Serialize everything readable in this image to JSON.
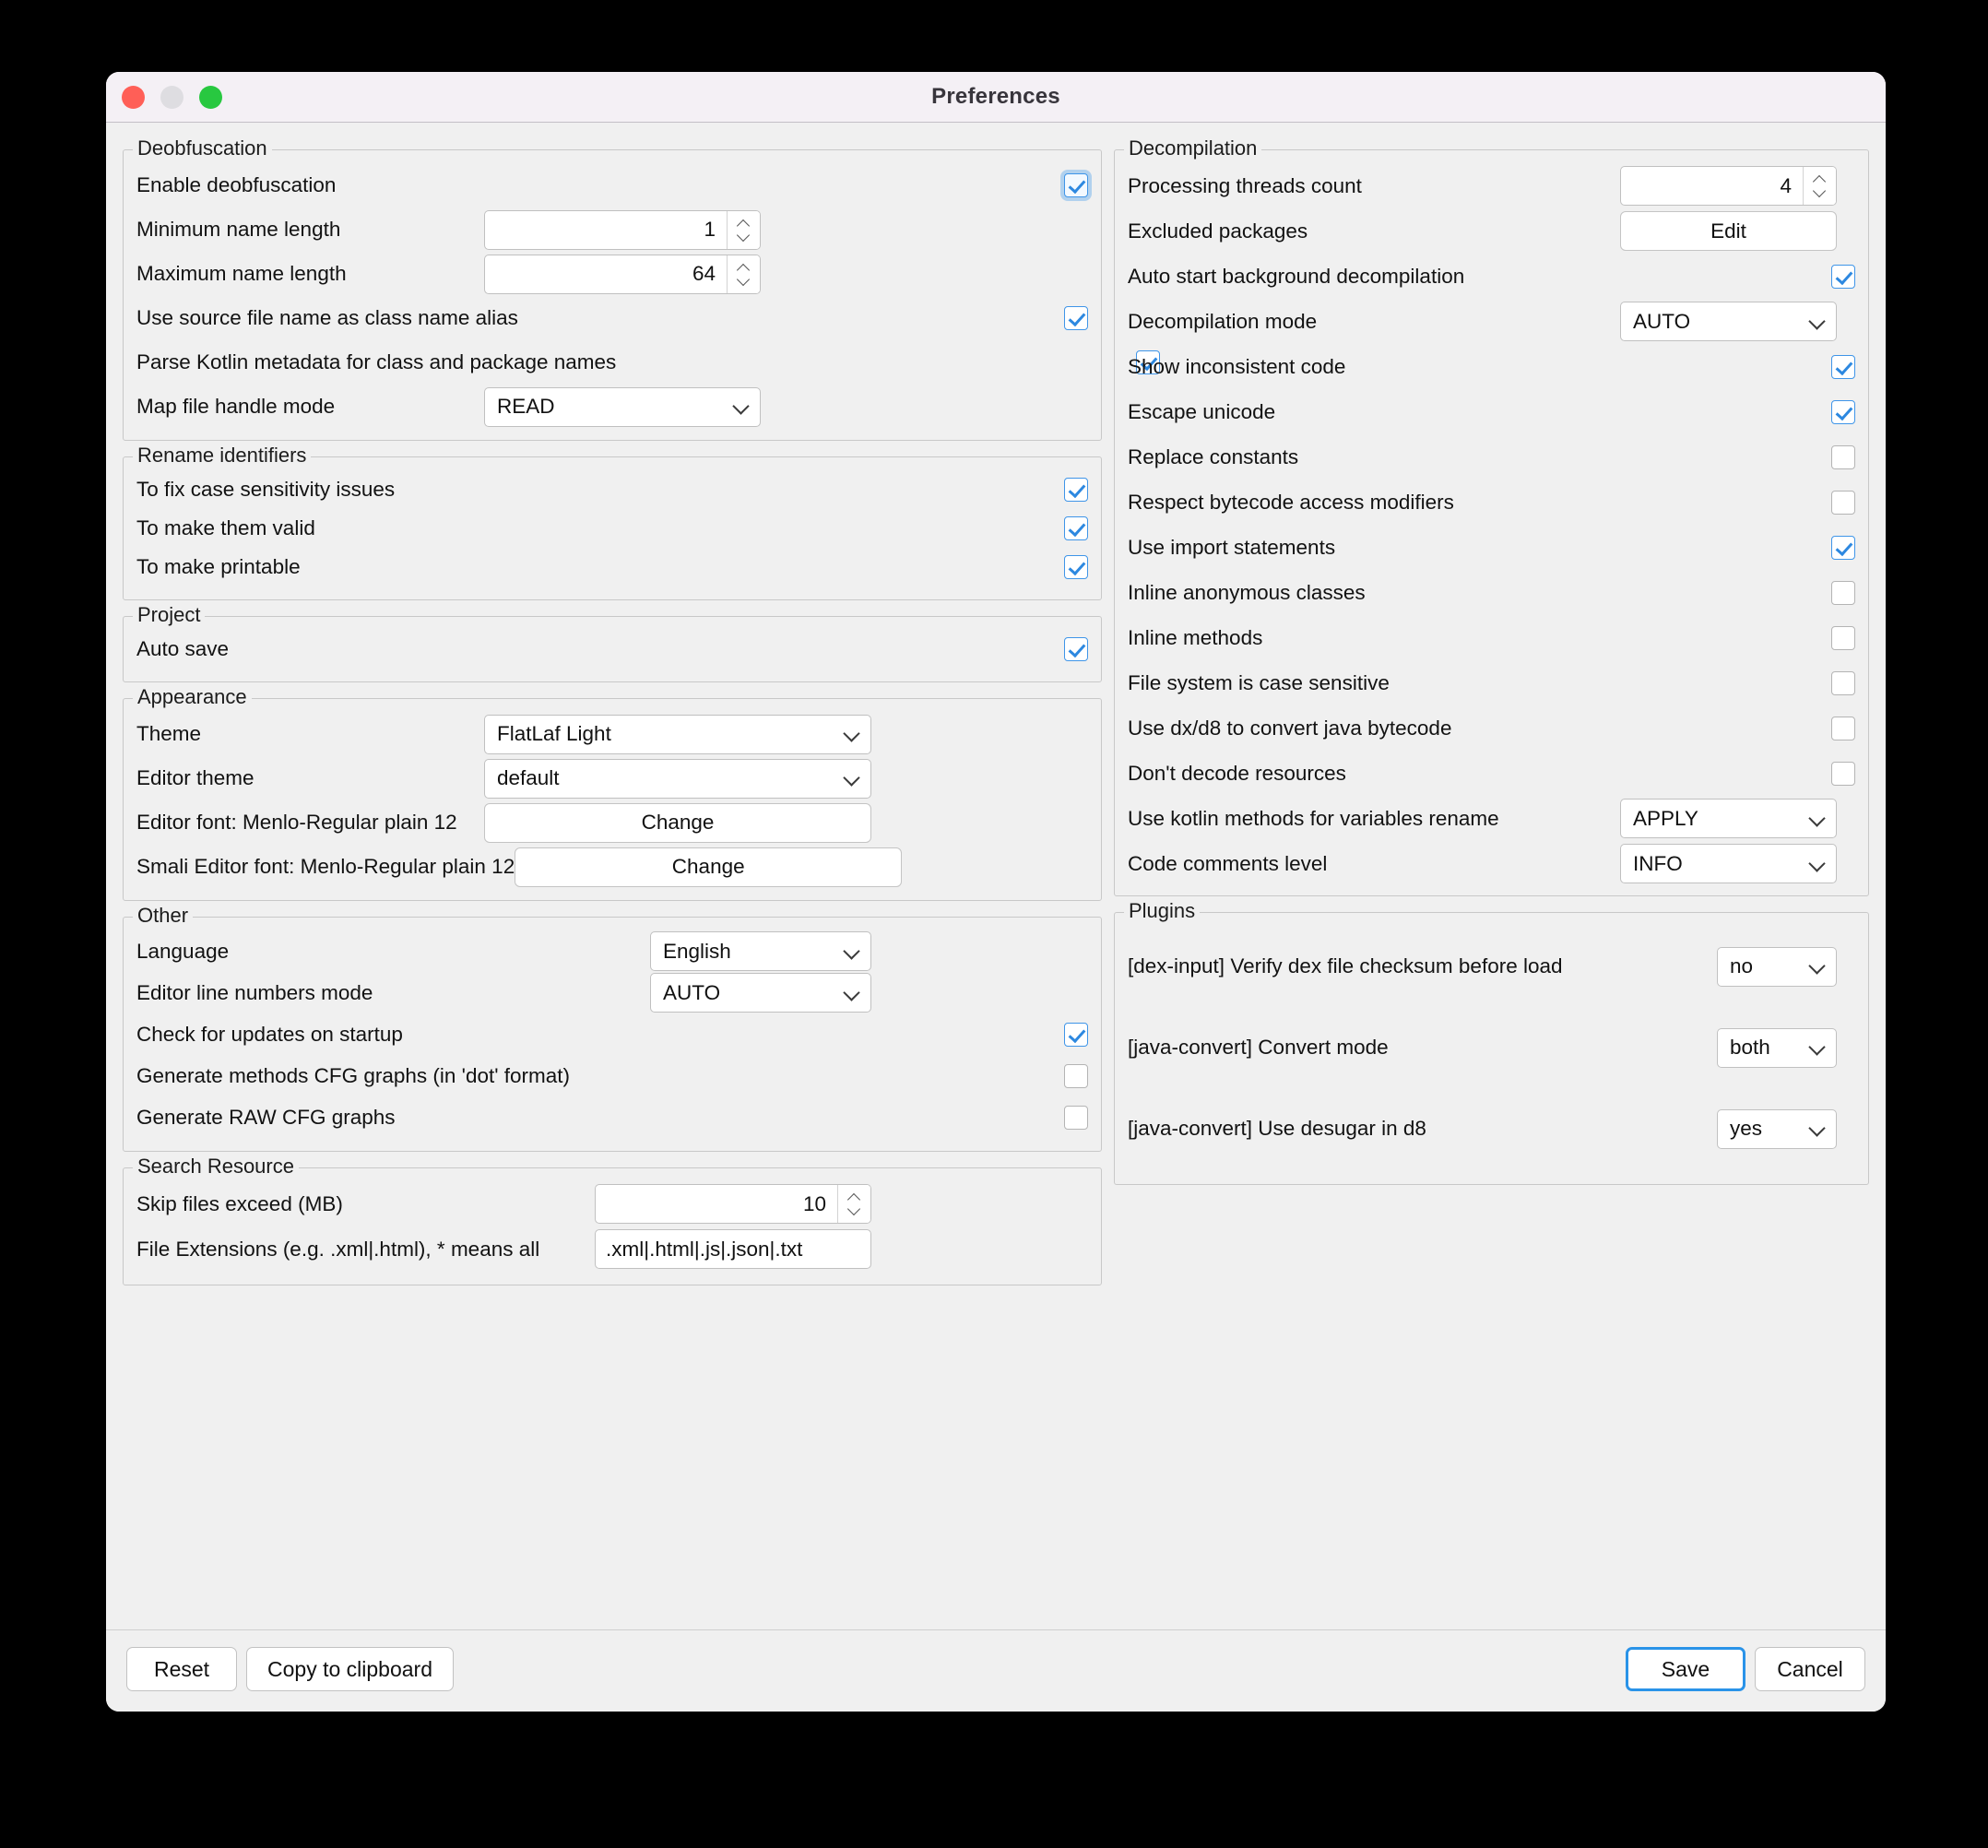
{
  "window": {
    "title": "Preferences",
    "traffic_lights": [
      "close-button",
      "minimize-button",
      "zoom-button"
    ]
  },
  "colors": {
    "accent": "#2a93e8",
    "checkbox_on": "#2d88e0",
    "close": "#ff5f57",
    "minimize": "#dedde1",
    "zoom": "#28c840",
    "window_bg": "#f0f0f0",
    "titlebar_bg": "#f4f0f5"
  },
  "left": {
    "deobfuscation": {
      "legend": "Deobfuscation",
      "rows": [
        {
          "label": "Enable deobfuscation",
          "type": "checkbox",
          "value": "on",
          "focused": true
        },
        {
          "label": "Minimum name length",
          "type": "spinner",
          "value": "1"
        },
        {
          "label": "Maximum name length",
          "type": "spinner",
          "value": "64"
        },
        {
          "label": "Use source file name as class name alias",
          "type": "checkbox",
          "value": "on"
        },
        {
          "label": "Parse Kotlin metadata for class and package names",
          "type": "checkbox",
          "value": "on"
        },
        {
          "label": "Map file handle mode",
          "type": "combo",
          "value": "READ"
        }
      ]
    },
    "rename_identifiers": {
      "legend": "Rename identifiers",
      "rows": [
        {
          "label": "To fix case sensitivity issues",
          "type": "checkbox",
          "value": "on"
        },
        {
          "label": "To make them valid",
          "type": "checkbox",
          "value": "on"
        },
        {
          "label": "To make printable",
          "type": "checkbox",
          "value": "on"
        }
      ]
    },
    "project": {
      "legend": "Project",
      "rows": [
        {
          "label": "Auto save",
          "type": "checkbox",
          "value": "on"
        }
      ]
    },
    "appearance": {
      "legend": "Appearance",
      "rows": [
        {
          "label": "Theme",
          "type": "combo",
          "value": "FlatLaf Light"
        },
        {
          "label": "Editor theme",
          "type": "combo",
          "value": "default"
        },
        {
          "label": "Editor font: Menlo-Regular plain 12",
          "type": "button",
          "value": "Change"
        },
        {
          "label": "Smali Editor font: Menlo-Regular plain 12",
          "type": "button",
          "value": "Change"
        }
      ]
    },
    "other": {
      "legend": "Other",
      "rows": [
        {
          "label": "Language",
          "type": "combo",
          "value": "English"
        },
        {
          "label": "Editor line numbers mode",
          "type": "combo",
          "value": "AUTO"
        },
        {
          "label": "Check for updates on startup",
          "type": "checkbox",
          "value": "on"
        },
        {
          "label": "Generate methods CFG graphs (in 'dot' format)",
          "type": "checkbox",
          "value": "off"
        },
        {
          "label": "Generate RAW CFG graphs",
          "type": "checkbox",
          "value": "off"
        }
      ]
    },
    "search_resource": {
      "legend": "Search Resource",
      "rows": [
        {
          "label": "Skip files exceed (MB)",
          "type": "spinner",
          "value": "10"
        },
        {
          "label": "File Extensions (e.g. .xml|.html), * means all",
          "type": "text",
          "value": ".xml|.html|.js|.json|.txt"
        }
      ]
    }
  },
  "right": {
    "decompilation": {
      "legend": "Decompilation",
      "rows": [
        {
          "label": "Processing threads count",
          "type": "spinner",
          "value": "4"
        },
        {
          "label": "Excluded packages",
          "type": "button",
          "value": "Edit"
        },
        {
          "label": "Auto start background decompilation",
          "type": "checkbox",
          "value": "on"
        },
        {
          "label": "Decompilation mode",
          "type": "combo",
          "value": "AUTO"
        },
        {
          "label": "Show inconsistent code",
          "type": "checkbox",
          "value": "on"
        },
        {
          "label": "Escape unicode",
          "type": "checkbox",
          "value": "on"
        },
        {
          "label": "Replace constants",
          "type": "checkbox",
          "value": "off"
        },
        {
          "label": "Respect bytecode access modifiers",
          "type": "checkbox",
          "value": "off"
        },
        {
          "label": "Use import statements",
          "type": "checkbox",
          "value": "on"
        },
        {
          "label": "Inline anonymous classes",
          "type": "checkbox",
          "value": "off"
        },
        {
          "label": "Inline methods",
          "type": "checkbox",
          "value": "off"
        },
        {
          "label": "File system is case sensitive",
          "type": "checkbox",
          "value": "off"
        },
        {
          "label": "Use dx/d8 to convert java bytecode",
          "type": "checkbox",
          "value": "off"
        },
        {
          "label": "Don't decode resources",
          "type": "checkbox",
          "value": "off"
        },
        {
          "label": "Use kotlin methods for variables rename",
          "type": "combo",
          "value": "APPLY"
        },
        {
          "label": "Code comments level",
          "type": "combo",
          "value": "INFO"
        }
      ]
    },
    "plugins": {
      "legend": "Plugins",
      "rows": [
        {
          "label": "[dex-input]  Verify dex file checksum before load",
          "type": "combo",
          "value": "no"
        },
        {
          "label": "[java-convert]  Convert mode",
          "type": "combo",
          "value": "both"
        },
        {
          "label": "[java-convert]  Use desugar in d8",
          "type": "combo",
          "value": "yes"
        }
      ]
    }
  },
  "footer": {
    "reset": "Reset",
    "copy": "Copy to clipboard",
    "save": "Save",
    "cancel": "Cancel"
  }
}
